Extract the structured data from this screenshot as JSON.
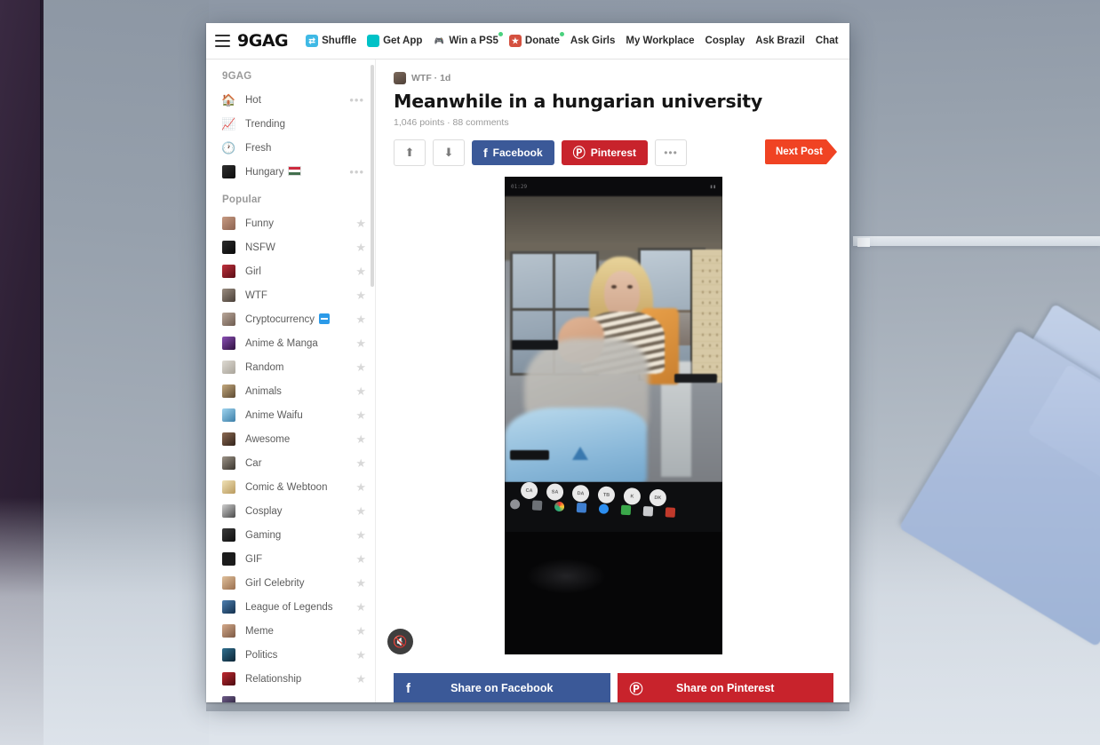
{
  "nav": {
    "menu_icon": "hamburger-icon",
    "logo": "9GAG",
    "items": [
      {
        "label": "Shuffle",
        "icon": "shuffle-icon",
        "dot": false
      },
      {
        "label": "Get App",
        "icon": "mobile-icon",
        "dot": false
      },
      {
        "label": "Win a PS5",
        "icon": "gamepad-icon",
        "dot": true
      },
      {
        "label": "Donate",
        "icon": "donate-icon",
        "dot": true
      },
      {
        "label": "Ask Girls",
        "icon": "",
        "dot": false
      },
      {
        "label": "My Workplace",
        "icon": "",
        "dot": false
      },
      {
        "label": "Cosplay",
        "icon": "",
        "dot": false
      },
      {
        "label": "Ask Brazil",
        "icon": "",
        "dot": false
      },
      {
        "label": "Chat",
        "icon": "",
        "dot": false
      }
    ]
  },
  "sidebar": {
    "section_one_title": "9GAG",
    "section_one": [
      {
        "label": "Hot",
        "icon": "home-icon",
        "menu": "•••",
        "has_menu": true
      },
      {
        "label": "Trending",
        "icon": "trending-icon",
        "menu": "",
        "has_menu": false
      },
      {
        "label": "Fresh",
        "icon": "clock-icon",
        "menu": "",
        "has_menu": false
      },
      {
        "label": "Hungary",
        "icon": "hungary-avatar",
        "menu": "•••",
        "has_menu": true,
        "flag": "hungary-flag-icon"
      }
    ],
    "section_two_title": "Popular",
    "section_two": [
      {
        "label": "Funny",
        "star": "★"
      },
      {
        "label": "NSFW",
        "star": "★"
      },
      {
        "label": "Girl",
        "star": "★"
      },
      {
        "label": "WTF",
        "star": "★"
      },
      {
        "label": "Cryptocurrency",
        "star": "★",
        "badge": "crypto-badge-icon"
      },
      {
        "label": "Anime & Manga",
        "star": "★"
      },
      {
        "label": "Random",
        "star": "★"
      },
      {
        "label": "Animals",
        "star": "★"
      },
      {
        "label": "Anime Waifu",
        "star": "★"
      },
      {
        "label": "Awesome",
        "star": "★"
      },
      {
        "label": "Car",
        "star": "★"
      },
      {
        "label": "Comic & Webtoon",
        "star": "★"
      },
      {
        "label": "Cosplay",
        "star": "★"
      },
      {
        "label": "Gaming",
        "star": "★"
      },
      {
        "label": "GIF",
        "star": "★"
      },
      {
        "label": "Girl Celebrity",
        "star": "★"
      },
      {
        "label": "League of Legends",
        "star": "★"
      },
      {
        "label": "Meme",
        "star": "★"
      },
      {
        "label": "Politics",
        "star": "★"
      },
      {
        "label": "Relationship",
        "star": "★"
      }
    ]
  },
  "post": {
    "section": "WTF",
    "time": "1d",
    "meta_line": "WTF · 1d",
    "title": "Meanwhile in a hungarian university",
    "stats": "1,046 points · 88 comments",
    "upvote_icon": "⬆",
    "downvote_icon": "⬇",
    "facebook_label": "Facebook",
    "facebook_icon": "f",
    "pinterest_label": "Pinterest",
    "pinterest_icon": "Ⓟ",
    "more_label": "•••",
    "next_post_label": "Next Post",
    "mute_icon": "🔇",
    "video_timestamp": "01:29"
  },
  "share": {
    "facebook_label": "Share on Facebook",
    "facebook_icon": "f",
    "pinterest_label": "Share on Pinterest",
    "pinterest_icon": "Ⓟ"
  },
  "video_dock": {
    "avatars": [
      "CA",
      "SA",
      "DA",
      "TB",
      "K",
      "DK"
    ]
  },
  "colors": {
    "facebook": "#3b5998",
    "pinterest": "#c8232c",
    "next_post": "#f04323",
    "accent_green": "#4ad17e",
    "crypto_badge": "#2b9ae8"
  }
}
